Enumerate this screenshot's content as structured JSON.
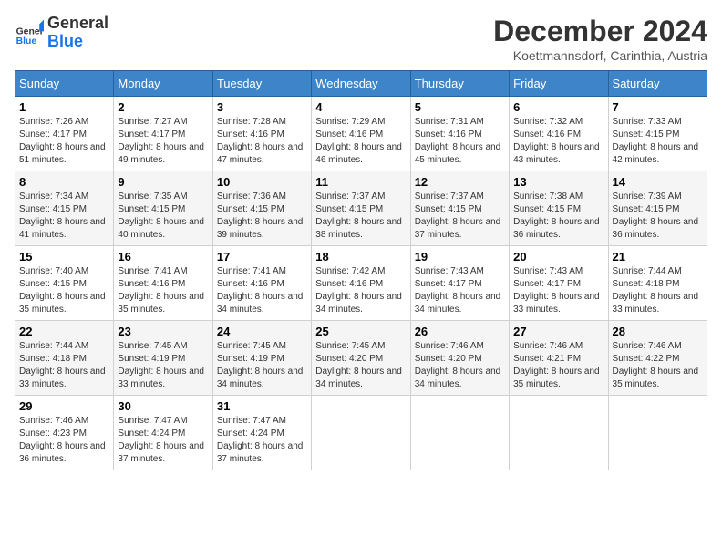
{
  "header": {
    "logo_line1": "General",
    "logo_line2": "Blue",
    "month_year": "December 2024",
    "location": "Koettmannsdorf, Carinthia, Austria"
  },
  "weekdays": [
    "Sunday",
    "Monday",
    "Tuesday",
    "Wednesday",
    "Thursday",
    "Friday",
    "Saturday"
  ],
  "weeks": [
    [
      {
        "day": "1",
        "sunrise": "7:26 AM",
        "sunset": "4:17 PM",
        "daylight": "8 hours and 51 minutes."
      },
      {
        "day": "2",
        "sunrise": "7:27 AM",
        "sunset": "4:17 PM",
        "daylight": "8 hours and 49 minutes."
      },
      {
        "day": "3",
        "sunrise": "7:28 AM",
        "sunset": "4:16 PM",
        "daylight": "8 hours and 47 minutes."
      },
      {
        "day": "4",
        "sunrise": "7:29 AM",
        "sunset": "4:16 PM",
        "daylight": "8 hours and 46 minutes."
      },
      {
        "day": "5",
        "sunrise": "7:31 AM",
        "sunset": "4:16 PM",
        "daylight": "8 hours and 45 minutes."
      },
      {
        "day": "6",
        "sunrise": "7:32 AM",
        "sunset": "4:16 PM",
        "daylight": "8 hours and 43 minutes."
      },
      {
        "day": "7",
        "sunrise": "7:33 AM",
        "sunset": "4:15 PM",
        "daylight": "8 hours and 42 minutes."
      }
    ],
    [
      {
        "day": "8",
        "sunrise": "7:34 AM",
        "sunset": "4:15 PM",
        "daylight": "8 hours and 41 minutes."
      },
      {
        "day": "9",
        "sunrise": "7:35 AM",
        "sunset": "4:15 PM",
        "daylight": "8 hours and 40 minutes."
      },
      {
        "day": "10",
        "sunrise": "7:36 AM",
        "sunset": "4:15 PM",
        "daylight": "8 hours and 39 minutes."
      },
      {
        "day": "11",
        "sunrise": "7:37 AM",
        "sunset": "4:15 PM",
        "daylight": "8 hours and 38 minutes."
      },
      {
        "day": "12",
        "sunrise": "7:37 AM",
        "sunset": "4:15 PM",
        "daylight": "8 hours and 37 minutes."
      },
      {
        "day": "13",
        "sunrise": "7:38 AM",
        "sunset": "4:15 PM",
        "daylight": "8 hours and 36 minutes."
      },
      {
        "day": "14",
        "sunrise": "7:39 AM",
        "sunset": "4:15 PM",
        "daylight": "8 hours and 36 minutes."
      }
    ],
    [
      {
        "day": "15",
        "sunrise": "7:40 AM",
        "sunset": "4:15 PM",
        "daylight": "8 hours and 35 minutes."
      },
      {
        "day": "16",
        "sunrise": "7:41 AM",
        "sunset": "4:16 PM",
        "daylight": "8 hours and 35 minutes."
      },
      {
        "day": "17",
        "sunrise": "7:41 AM",
        "sunset": "4:16 PM",
        "daylight": "8 hours and 34 minutes."
      },
      {
        "day": "18",
        "sunrise": "7:42 AM",
        "sunset": "4:16 PM",
        "daylight": "8 hours and 34 minutes."
      },
      {
        "day": "19",
        "sunrise": "7:43 AM",
        "sunset": "4:17 PM",
        "daylight": "8 hours and 34 minutes."
      },
      {
        "day": "20",
        "sunrise": "7:43 AM",
        "sunset": "4:17 PM",
        "daylight": "8 hours and 33 minutes."
      },
      {
        "day": "21",
        "sunrise": "7:44 AM",
        "sunset": "4:18 PM",
        "daylight": "8 hours and 33 minutes."
      }
    ],
    [
      {
        "day": "22",
        "sunrise": "7:44 AM",
        "sunset": "4:18 PM",
        "daylight": "8 hours and 33 minutes."
      },
      {
        "day": "23",
        "sunrise": "7:45 AM",
        "sunset": "4:19 PM",
        "daylight": "8 hours and 33 minutes."
      },
      {
        "day": "24",
        "sunrise": "7:45 AM",
        "sunset": "4:19 PM",
        "daylight": "8 hours and 34 minutes."
      },
      {
        "day": "25",
        "sunrise": "7:45 AM",
        "sunset": "4:20 PM",
        "daylight": "8 hours and 34 minutes."
      },
      {
        "day": "26",
        "sunrise": "7:46 AM",
        "sunset": "4:20 PM",
        "daylight": "8 hours and 34 minutes."
      },
      {
        "day": "27",
        "sunrise": "7:46 AM",
        "sunset": "4:21 PM",
        "daylight": "8 hours and 35 minutes."
      },
      {
        "day": "28",
        "sunrise": "7:46 AM",
        "sunset": "4:22 PM",
        "daylight": "8 hours and 35 minutes."
      }
    ],
    [
      {
        "day": "29",
        "sunrise": "7:46 AM",
        "sunset": "4:23 PM",
        "daylight": "8 hours and 36 minutes."
      },
      {
        "day": "30",
        "sunrise": "7:47 AM",
        "sunset": "4:24 PM",
        "daylight": "8 hours and 37 minutes."
      },
      {
        "day": "31",
        "sunrise": "7:47 AM",
        "sunset": "4:24 PM",
        "daylight": "8 hours and 37 minutes."
      },
      null,
      null,
      null,
      null
    ]
  ]
}
